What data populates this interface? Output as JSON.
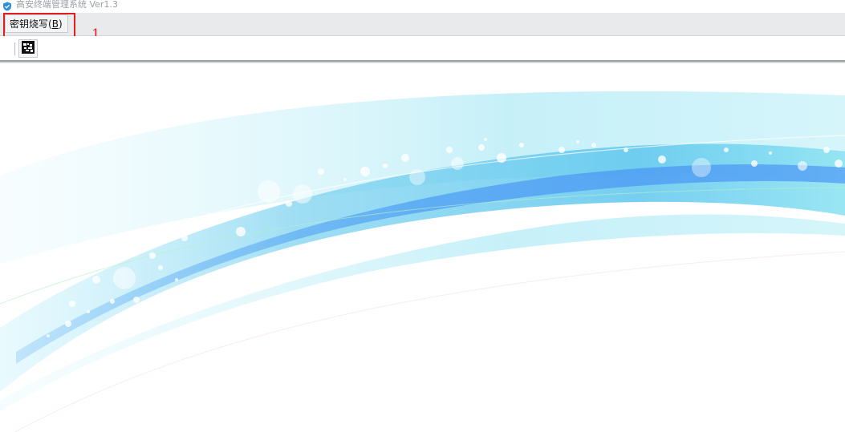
{
  "window": {
    "title": "高安终端管理系统 Ver1.3",
    "icon": "shield-app-icon"
  },
  "menubar": {
    "items": [
      {
        "label": "密钥烧写",
        "shortcut_open": "(",
        "shortcut_key": "B",
        "shortcut_close": ")"
      }
    ]
  },
  "annotation": {
    "number": "1",
    "color": "#e02020"
  },
  "toolbar": {
    "buttons": [
      {
        "icon": "key-burn-icon"
      }
    ]
  },
  "theme": {
    "wave_colors": [
      "#7fd3f0",
      "#4fa8f5",
      "#a8e8f5",
      "#3b82f6"
    ]
  }
}
